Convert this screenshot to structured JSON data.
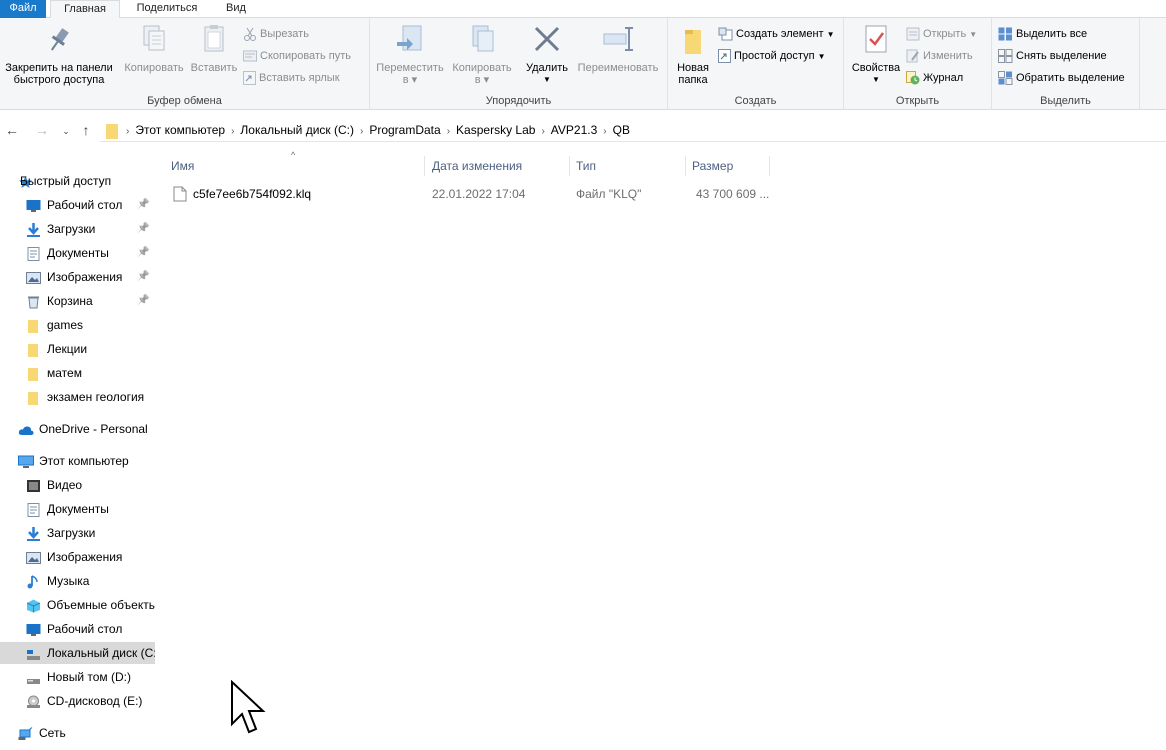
{
  "menu": {
    "file": "Файл",
    "home": "Главная",
    "share": "Поделиться",
    "view": "Вид"
  },
  "ribbon": {
    "clipboard": {
      "label": "Буфер обмена",
      "pin": "Закрепить на панели быстрого доступа",
      "pin_l1": "Закрепить на панели",
      "pin_l2": "быстрого доступа",
      "copy": "Копировать",
      "paste": "Вставить",
      "cut": "Вырезать",
      "copy_path": "Скопировать путь",
      "paste_shortcut": "Вставить ярлык"
    },
    "organize": {
      "label": "Упорядочить",
      "move_l1": "Переместить",
      "move_l2": "в",
      "copy_l1": "Копировать",
      "copy_l2": "в",
      "delete": "Удалить",
      "rename": "Переименовать"
    },
    "create": {
      "label": "Создать",
      "new_folder_l1": "Новая",
      "new_folder_l2": "папка",
      "new_item": "Создать элемент",
      "easy_access": "Простой доступ"
    },
    "open": {
      "label": "Открыть",
      "properties": "Свойства",
      "open": "Открыть",
      "edit": "Изменить",
      "history": "Журнал"
    },
    "select": {
      "label": "Выделить",
      "select_all": "Выделить все",
      "select_none": "Снять выделение",
      "invert": "Обратить выделение"
    }
  },
  "address": {
    "crumbs": [
      "Этот компьютер",
      "Локальный диск (C:)",
      "ProgramData",
      "Kaspersky Lab",
      "AVP21.3",
      "QB"
    ]
  },
  "nav": {
    "quick_access": "Быстрый доступ",
    "quick_items": [
      "Рабочий стол",
      "Загрузки",
      "Документы",
      "Изображения",
      "Корзина",
      "games",
      "Лекции",
      "матем",
      "экзамен геология"
    ],
    "onedrive": "OneDrive - Personal",
    "this_pc": "Этот компьютер",
    "pc_items": [
      "Видео",
      "Документы",
      "Загрузки",
      "Изображения",
      "Музыка",
      "Объемные объекты",
      "Рабочий стол",
      "Локальный диск (C:)",
      "Новый том (D:)",
      "CD-дисковод (E:)"
    ],
    "network": "Сеть"
  },
  "columns": {
    "name": "Имя",
    "date": "Дата изменения",
    "type": "Тип",
    "size": "Размер"
  },
  "files": [
    {
      "name": "c5fe7ee6b754f092.klq",
      "date": "22.01.2022 17:04",
      "type": "Файл \"KLQ\"",
      "size": "43 700 609 ..."
    }
  ],
  "colors": {
    "accent": "#1979ca",
    "folder": "#f8d775",
    "ribbon_bg": "#f5f6f7",
    "header_text": "#4d6082"
  }
}
